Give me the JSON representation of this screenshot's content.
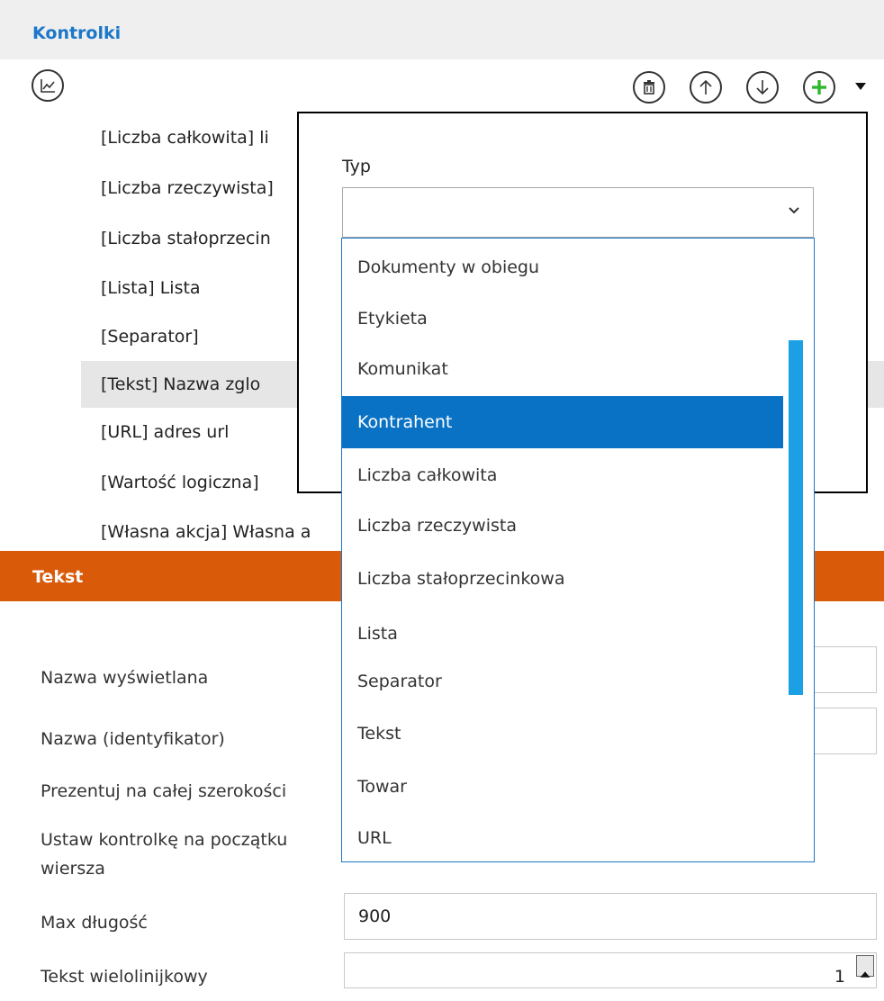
{
  "header": {
    "title": "Kontrolki"
  },
  "toolbar": {
    "chart_icon": "chart-line-icon",
    "delete_icon": "trash-icon",
    "up_icon": "arrow-up-icon",
    "down_icon": "arrow-down-icon",
    "add_icon": "plus-icon",
    "add_color": "#2db82d"
  },
  "controls_list": [
    {
      "label": "[Liczba całkowita] li",
      "selected": false
    },
    {
      "label": "[Liczba rzeczywista]",
      "selected": false
    },
    {
      "label": "[Liczba stałoprzecin",
      "selected": false
    },
    {
      "label": "[Lista] Lista",
      "selected": false
    },
    {
      "label": "[Separator]",
      "selected": false
    },
    {
      "label": "[Tekst] Nazwa zglo",
      "selected": true
    },
    {
      "label": "[URL] adres url",
      "selected": false
    },
    {
      "label": "[Wartość logiczna]",
      "selected": false
    },
    {
      "label": "[Własna akcja] Własna a",
      "selected": false
    }
  ],
  "section": {
    "title": "Tekst",
    "color": "#d95a08"
  },
  "form": {
    "display_name_label": "Nazwa wyświetlana",
    "identifier_label": "Nazwa (identyfikator)",
    "full_width_label": "Prezentuj na całej szerokości",
    "row_start_label_line1": "Ustaw kontrolkę na początku",
    "row_start_label_line2": "wiersza",
    "max_length_label": "Max długość",
    "max_length_value": "900",
    "multiline_label": "Tekst wielolinijkowy",
    "multiline_value": "1"
  },
  "type_popup": {
    "label": "Typ",
    "selected_value": "",
    "options": [
      "Dokumenty w obiegu",
      "Etykieta",
      "Komunikat",
      "Kontrahent",
      "Liczba całkowita",
      "Liczba rzeczywista",
      "Liczba stałoprzecinkowa",
      "Lista",
      "Separator",
      "Tekst",
      "Towar",
      "URL"
    ],
    "highlighted": "Kontrahent",
    "highlight_color": "#0a72c4"
  }
}
